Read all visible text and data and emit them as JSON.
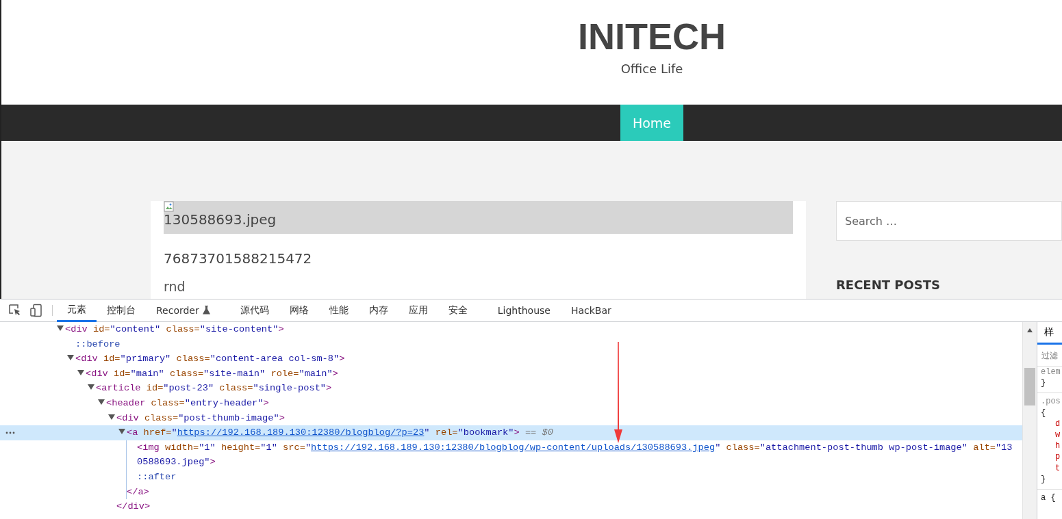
{
  "site": {
    "title": "INITECH",
    "tagline": "Office Life",
    "nav": [
      {
        "label": "Home",
        "selected": true
      }
    ],
    "post": {
      "image_alt": "130588693.jpeg",
      "title": "76873701588215472",
      "text": "rnd"
    },
    "sidebar": {
      "search": {
        "placeholder": "Search …"
      },
      "heading": "RECENT POSTS"
    }
  },
  "devtools": {
    "tabs": [
      {
        "label": "元素",
        "selected": true
      },
      {
        "label": "控制台",
        "selected": false
      },
      {
        "label": "Recorder",
        "selected": false,
        "kind": "flask"
      },
      {
        "label": "源代码",
        "selected": false
      },
      {
        "label": "网络",
        "selected": false
      },
      {
        "label": "性能",
        "selected": false
      },
      {
        "label": "内存",
        "selected": false
      },
      {
        "label": "应用",
        "selected": false
      },
      {
        "label": "安全",
        "selected": false
      },
      {
        "label": "Lighthouse",
        "selected": false
      },
      {
        "label": "HackBar",
        "selected": false
      }
    ],
    "dom": [
      {
        "expanded": true,
        "selected": false,
        "tokens": [
          {
            "kind": "tag",
            "text": "<div"
          },
          {
            "kind": "attr",
            "text": " id="
          },
          {
            "kind": "val",
            "text": "\"content\""
          },
          {
            "kind": "attr",
            "text": " class="
          },
          {
            "kind": "val",
            "text": "\"site-content\""
          },
          {
            "kind": "tag",
            "text": ">"
          }
        ],
        "children": [
          {
            "selected": false,
            "tokens": [
              {
                "kind": "pseudo",
                "text": "::before"
              }
            ]
          },
          {
            "expanded": true,
            "selected": false,
            "tokens": [
              {
                "kind": "tag",
                "text": "<div"
              },
              {
                "kind": "attr",
                "text": " id="
              },
              {
                "kind": "val",
                "text": "\"primary\""
              },
              {
                "kind": "attr",
                "text": " class="
              },
              {
                "kind": "val",
                "text": "\"content-area col-sm-8\""
              },
              {
                "kind": "tag",
                "text": ">"
              }
            ],
            "children": [
              {
                "expanded": true,
                "selected": false,
                "tokens": [
                  {
                    "kind": "tag",
                    "text": "<div"
                  },
                  {
                    "kind": "attr",
                    "text": " id="
                  },
                  {
                    "kind": "val",
                    "text": "\"main\""
                  },
                  {
                    "kind": "attr",
                    "text": " class="
                  },
                  {
                    "kind": "val",
                    "text": "\"site-main\""
                  },
                  {
                    "kind": "attr",
                    "text": " role="
                  },
                  {
                    "kind": "val",
                    "text": "\"main\""
                  },
                  {
                    "kind": "tag",
                    "text": ">"
                  }
                ],
                "children": [
                  {
                    "expanded": true,
                    "selected": false,
                    "tokens": [
                      {
                        "kind": "tag",
                        "text": "<article"
                      },
                      {
                        "kind": "attr",
                        "text": " id="
                      },
                      {
                        "kind": "val",
                        "text": "\"post-23\""
                      },
                      {
                        "kind": "attr",
                        "text": " class="
                      },
                      {
                        "kind": "val",
                        "text": "\"single-post\""
                      },
                      {
                        "kind": "tag",
                        "text": ">"
                      }
                    ],
                    "children": [
                      {
                        "expanded": true,
                        "selected": false,
                        "tokens": [
                          {
                            "kind": "tag",
                            "text": "<header"
                          },
                          {
                            "kind": "attr",
                            "text": " class="
                          },
                          {
                            "kind": "val",
                            "text": "\"entry-header\""
                          },
                          {
                            "kind": "tag",
                            "text": ">"
                          }
                        ],
                        "children": [
                          {
                            "expanded": true,
                            "selected": false,
                            "tokens": [
                              {
                                "kind": "tag",
                                "text": "<div"
                              },
                              {
                                "kind": "attr",
                                "text": " class="
                              },
                              {
                                "kind": "val",
                                "text": "\"post-thumb-image\""
                              },
                              {
                                "kind": "tag",
                                "text": ">"
                              }
                            ],
                            "close": [
                              {
                                "kind": "tag",
                                "text": "</div>"
                              }
                            ],
                            "children": [
                              {
                                "expanded": true,
                                "selected": true,
                                "tokens": [
                                  {
                                    "kind": "tag",
                                    "text": "<a"
                                  },
                                  {
                                    "kind": "attr",
                                    "text": " href="
                                  },
                                  {
                                    "kind": "val",
                                    "text": "\""
                                  },
                                  {
                                    "kind": "link",
                                    "text": "https://192.168.189.130:12380/blogblog/?p=23"
                                  },
                                  {
                                    "kind": "val",
                                    "text": "\""
                                  },
                                  {
                                    "kind": "attr",
                                    "text": " rel="
                                  },
                                  {
                                    "kind": "val",
                                    "text": "\"bookmark\""
                                  },
                                  {
                                    "kind": "tag",
                                    "text": ">"
                                  },
                                  {
                                    "kind": "hint",
                                    "text": " == $0"
                                  }
                                ],
                                "close": [
                                  {
                                    "kind": "tag",
                                    "text": "</a>"
                                  }
                                ],
                                "children": [
                                  {
                                    "selected": false,
                                    "tokens": [
                                      {
                                        "kind": "tag",
                                        "text": "<img"
                                      },
                                      {
                                        "kind": "attr",
                                        "text": " width="
                                      },
                                      {
                                        "kind": "val",
                                        "text": "\"1\""
                                      },
                                      {
                                        "kind": "attr",
                                        "text": " height="
                                      },
                                      {
                                        "kind": "val",
                                        "text": "\"1\""
                                      },
                                      {
                                        "kind": "attr",
                                        "text": " src="
                                      },
                                      {
                                        "kind": "val",
                                        "text": "\""
                                      },
                                      {
                                        "kind": "link",
                                        "text": "https://192.168.189.130:12380/blogblog/wp-content/uploads/130588693.jpeg"
                                      },
                                      {
                                        "kind": "val",
                                        "text": "\""
                                      },
                                      {
                                        "kind": "attr",
                                        "text": " class="
                                      },
                                      {
                                        "kind": "val",
                                        "text": "\"attachment-post-thumb wp-post-image\""
                                      },
                                      {
                                        "kind": "attr",
                                        "text": " alt="
                                      },
                                      {
                                        "kind": "val",
                                        "text": "\"130588693.jpeg\""
                                      },
                                      {
                                        "kind": "tag",
                                        "text": ">"
                                      }
                                    ]
                                  },
                                  {
                                    "selected": false,
                                    "tokens": [
                                      {
                                        "kind": "pseudo",
                                        "text": "::after"
                                      }
                                    ]
                                  }
                                ]
                              }
                            ]
                          }
                        ]
                      }
                    ]
                  }
                ]
              }
            ]
          }
        ]
      }
    ],
    "styles": {
      "tabs": [
        {
          "label": "样",
          "selected": true
        }
      ],
      "filter": {
        "placeholder": "过滤"
      },
      "lines": [
        {
          "kind": "sel",
          "text": "elem"
        },
        {
          "kind": "brace",
          "text": "}"
        },
        {
          "kind": "sep"
        },
        {
          "kind": "sel",
          "text": ".pos"
        },
        {
          "kind": "brace",
          "text": "{"
        },
        {
          "kind": "prop",
          "text": "d"
        },
        {
          "kind": "prop",
          "text": "w"
        },
        {
          "kind": "prop",
          "text": "h"
        },
        {
          "kind": "prop",
          "text": "p"
        },
        {
          "kind": "prop",
          "text": "t"
        },
        {
          "kind": "brace",
          "text": "}"
        },
        {
          "kind": "sep"
        },
        {
          "kind": "brace",
          "text": "a {"
        }
      ]
    }
  }
}
